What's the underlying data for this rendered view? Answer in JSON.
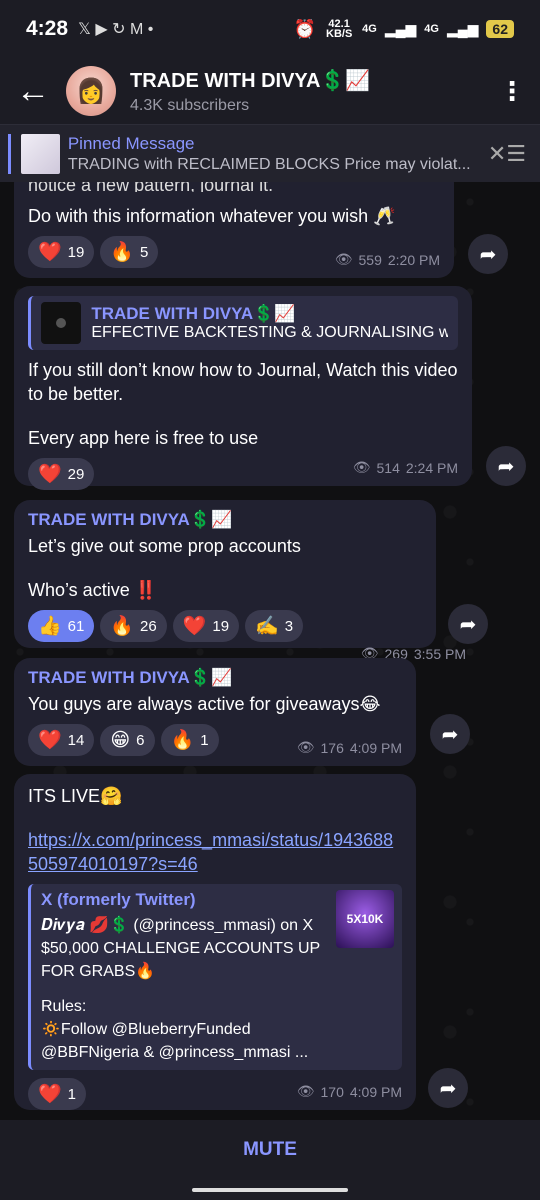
{
  "status": {
    "time": "4:28",
    "apps": "𝕏 ▶ ↻ M •",
    "net_speed": "42.1 KB/S",
    "sig1": "4G",
    "sig2": "4G",
    "battery": "62"
  },
  "header": {
    "title": "TRADE WITH DIVYA💲📈",
    "subtitle": "4.3K subscribers"
  },
  "pinned": {
    "title": "Pinned Message",
    "body": "TRADING with RECLAIMED BLOCKS  Price may violat..."
  },
  "messages": [
    {
      "text_cut": "notice a new pattern, journal it.",
      "text": "Do with this information whatever you wish 🥂",
      "reactions": [
        {
          "emoji": "❤️",
          "count": "19"
        },
        {
          "emoji": "🔥",
          "count": "5"
        }
      ],
      "views": "559",
      "time": "2:20 PM"
    },
    {
      "quote_title": "TRADE WITH DIVYA💲📈",
      "quote_body": "EFFECTIVE BACKTESTING & JOURNALISING w...",
      "text1": "If you still don’t know how to Journal, Watch this video to be better.",
      "text2": "Every app here is free to use",
      "reactions": [
        {
          "emoji": "❤️",
          "count": "29"
        }
      ],
      "views": "514",
      "time": "2:24 PM"
    },
    {
      "sender": "TRADE WITH DIVYA💲📈",
      "text1": "Let’s give out some prop accounts",
      "text2": "Who’s active ‼️",
      "reactions": [
        {
          "emoji": "👍",
          "count": "61"
        },
        {
          "emoji": "🔥",
          "count": "26"
        },
        {
          "emoji": "❤️",
          "count": "19"
        },
        {
          "emoji": "✍️",
          "count": "3"
        }
      ],
      "views": "269",
      "time": "3:55 PM"
    },
    {
      "sender": "TRADE WITH DIVYA💲📈",
      "text": "You guys are always active for giveaways😂",
      "reactions": [
        {
          "emoji": "❤️",
          "count": "14"
        },
        {
          "emoji": "😁",
          "count": "6"
        },
        {
          "emoji": "🔥",
          "count": "1"
        }
      ],
      "views": "176",
      "time": "4:09 PM"
    },
    {
      "text": "ITS LIVE🤗",
      "link": "https://x.com/princess_mmasi/status/1943688505974010197?s=46",
      "preview_site": "X (formerly Twitter)",
      "preview_line1": "𝑫𝒊𝒗𝒚𝒂 💋💲 (@princess_mmasi) on X",
      "preview_line2": "$50,000 CHALLENGE ACCOUNTS UP FOR GRABS🔥",
      "preview_line3": "Rules:",
      "preview_line4": "🔅Follow @BlueberryFunded @BBFNigeria & @princess_mmasi ...",
      "preview_thumb": "5X10K",
      "reactions": [
        {
          "emoji": "❤️",
          "count": "1"
        }
      ],
      "views": "170",
      "time": "4:09 PM"
    }
  ],
  "footer": {
    "mute_label": "MUTE"
  }
}
